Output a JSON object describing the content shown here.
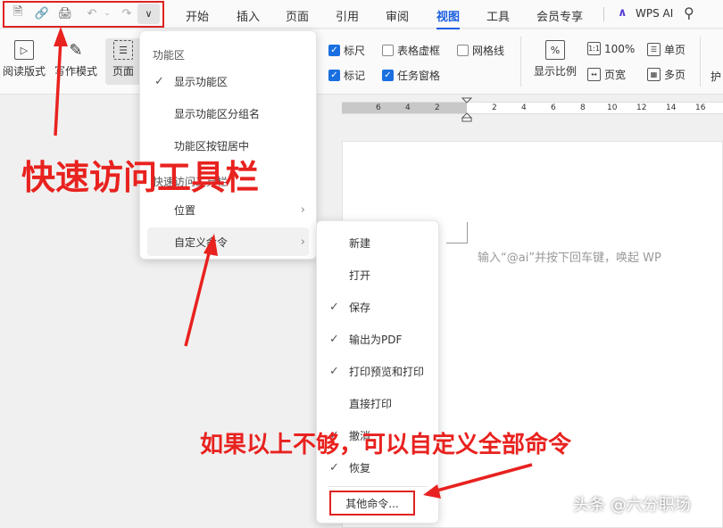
{
  "menu_tabs": [
    "开始",
    "插入",
    "页面",
    "引用",
    "审阅",
    "视图",
    "工具",
    "会员专享"
  ],
  "active_tab": "视图",
  "wps_ai": "WPS AI",
  "ribbon": {
    "read_mode": "阅读版式",
    "write_mode": "写作模式",
    "page": "页面",
    "checkboxes": [
      {
        "label": "标尺",
        "checked": true
      },
      {
        "label": "表格虚框",
        "checked": false
      },
      {
        "label": "网格线",
        "checked": false
      },
      {
        "label": "标记",
        "checked": true
      },
      {
        "label": "任务窗格",
        "checked": true
      }
    ],
    "zoom": "显示比例",
    "zoom_100": "100%",
    "page_width": "页宽",
    "single_page": "单页",
    "multi_page": "多页",
    "protect_partial": "护"
  },
  "ruler_numbers": [
    "6",
    "4",
    "2",
    "2",
    "4",
    "6",
    "8",
    "10",
    "12",
    "14",
    "16"
  ],
  "doc_hint": "输入“@ai”并按下回车键，唤起 WP",
  "menu1": {
    "header1": "功能区",
    "show_ribbon": "显示功能区",
    "show_group_names": "显示功能区分组名",
    "center_buttons": "功能区按钮居中",
    "header2": "快速访问工具栏",
    "position": "位置",
    "custom_commands": "自定义命令"
  },
  "submenu": {
    "items": [
      {
        "label": "新建",
        "checked": false
      },
      {
        "label": "打开",
        "checked": false
      },
      {
        "label": "保存",
        "checked": true
      },
      {
        "label": "输出为PDF",
        "checked": true
      },
      {
        "label": "打印预览和打印",
        "checked": true
      },
      {
        "label": "直接打印",
        "checked": false
      },
      {
        "label": "撤消",
        "checked": true
      },
      {
        "label": "恢复",
        "checked": true
      }
    ],
    "other": "其他命令..."
  },
  "annotations": {
    "quick_access": "快速访问工具栏",
    "customize_all": "如果以上不够，可以自定义全部命令",
    "color": "#e8221f"
  },
  "watermark": "头条 @六分职场"
}
